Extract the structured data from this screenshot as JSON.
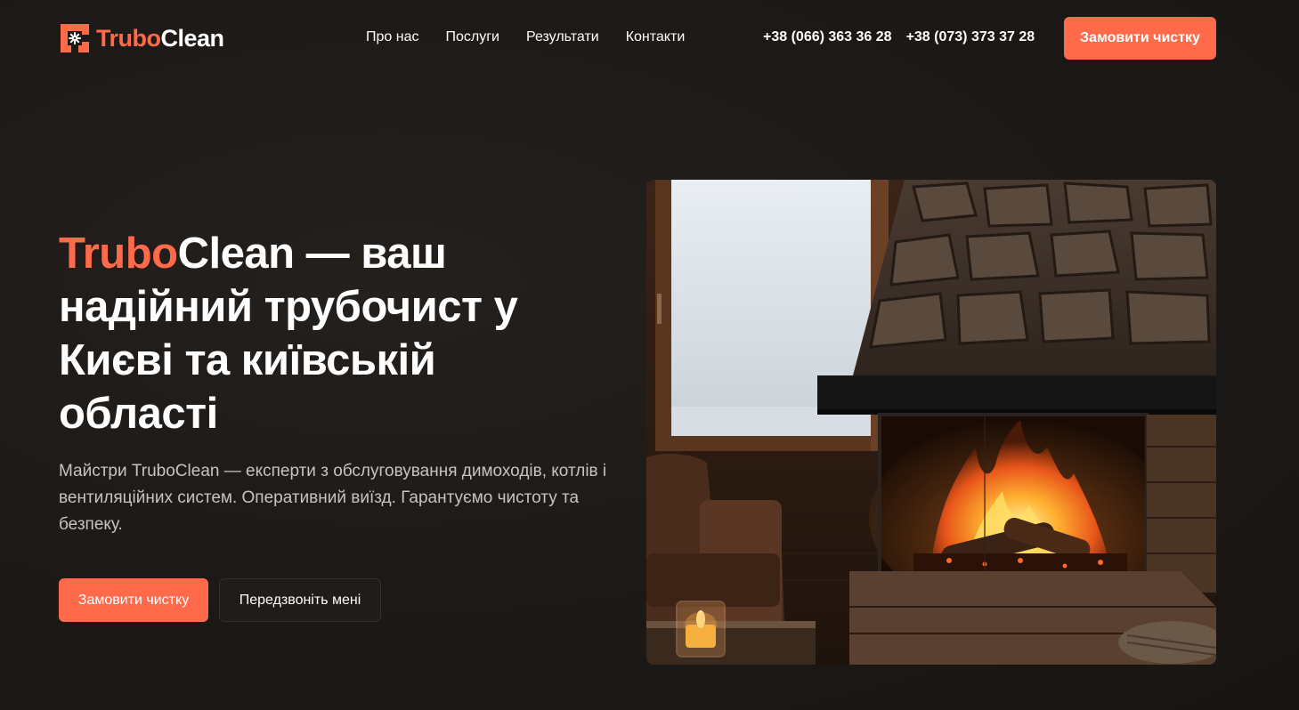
{
  "header": {
    "logo": {
      "part1": "Trubo",
      "part2": "Clean"
    },
    "nav": [
      {
        "label": "Про нас"
      },
      {
        "label": "Послуги"
      },
      {
        "label": "Результати"
      },
      {
        "label": "Контакти"
      }
    ],
    "phones": [
      {
        "label": "+38 (066) 363 36 28"
      },
      {
        "label": "+38 (073) 373 37 28"
      }
    ],
    "cta_label": "Замовити чистку"
  },
  "hero": {
    "title_accent": "Trubo",
    "title_rest": "Clean — ваш надійний трубочист у Києві та київській області",
    "description": "Майстри TruboClean — експерти з обслуговування димоходів, котлів і вентиляційних систем. Оперативний виїзд. Гарантуємо чистоту та безпеку.",
    "primary_button": "Замовити чистку",
    "secondary_button": "Передзвоніть мені",
    "image": "fireplace-with-window-and-armchair"
  },
  "colors": {
    "accent": "#ff6a4a",
    "background": "#1c1917",
    "text": "#ffffff",
    "muted_text": "#c9c3be"
  }
}
